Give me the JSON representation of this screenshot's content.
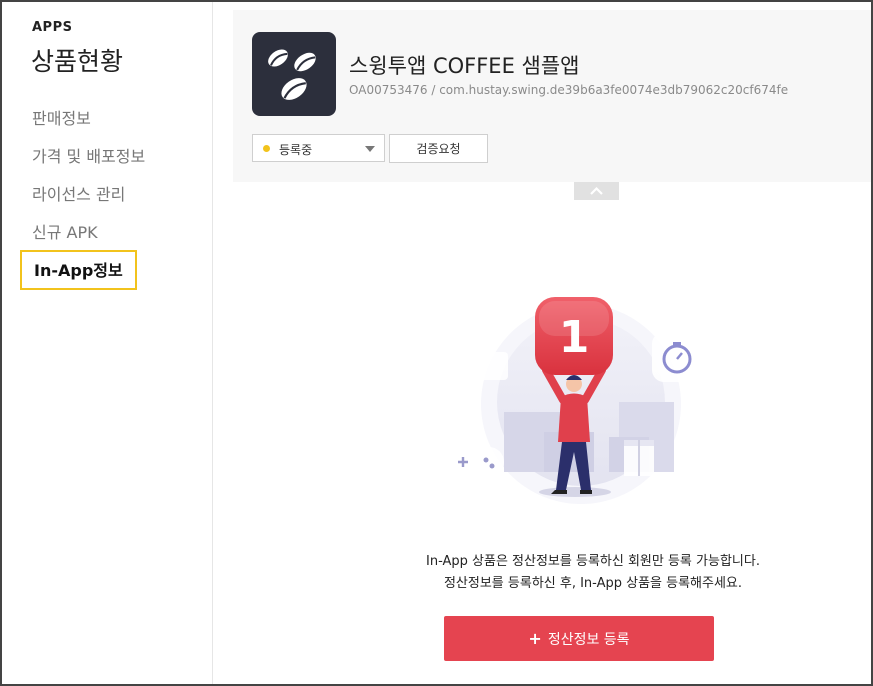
{
  "sidebar": {
    "section_label": "APPS",
    "title": "상품현황",
    "items": [
      {
        "label": "판매정보"
      },
      {
        "label": "가격 및 배포정보"
      },
      {
        "label": "라이선스 관리"
      },
      {
        "label": "신규 APK"
      },
      {
        "label": "In-App정보",
        "active": true
      }
    ]
  },
  "app": {
    "name": "스윙투앱 COFFEE 샘플앱",
    "id": "OA00753476 / com.hustay.swing.de39b6a3fe0074e3db79062c20cf674fe",
    "icon": "coffee-beans-icon"
  },
  "controls": {
    "status_value": "등록중",
    "status_color": "#f2c31c",
    "verify_label": "검증요청"
  },
  "illustration": {
    "badge_number": "1"
  },
  "notice": {
    "line1": "In-App 상품은 정산정보를 등록하신 회원만 등록 가능합니다.",
    "line2": "정산정보를 등록하신 후, In-App 상품을 등록해주세요."
  },
  "register_button": {
    "plus": "+",
    "label": "정산정보 등록"
  },
  "colors": {
    "accent": "#e54450",
    "highlight_border": "#f2c31c"
  }
}
